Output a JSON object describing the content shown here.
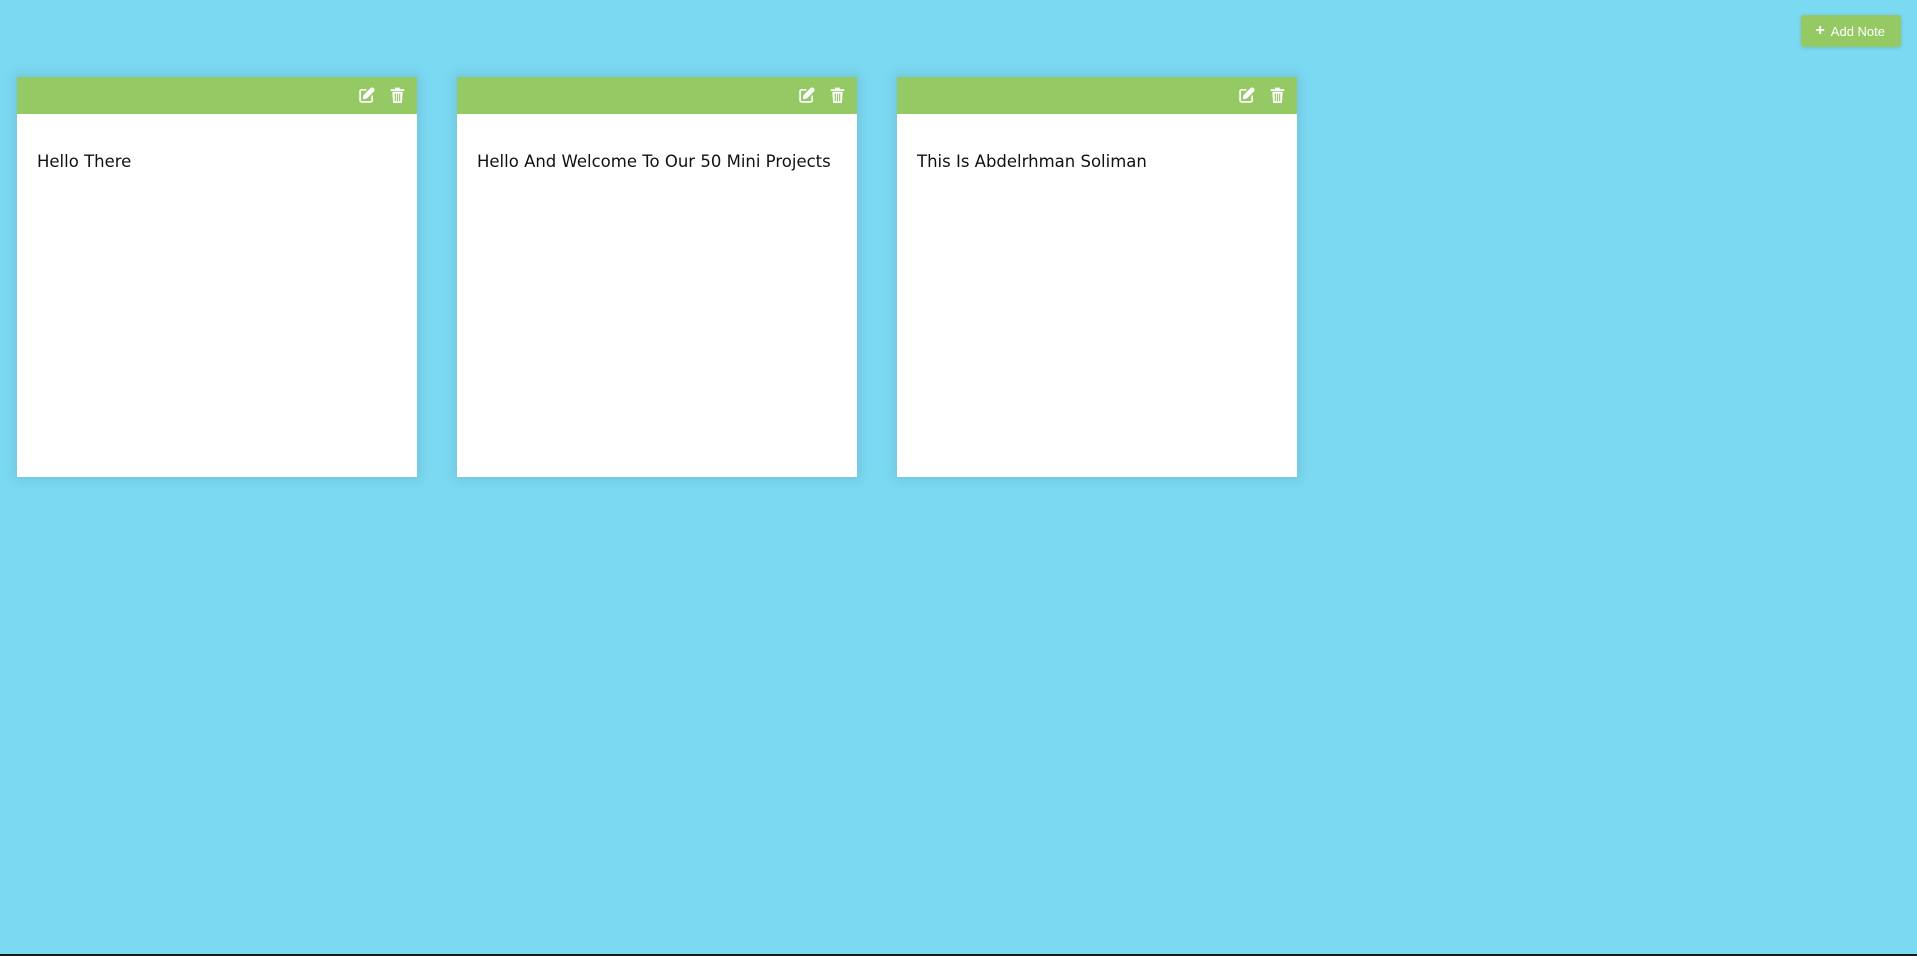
{
  "toolbar": {
    "add_icon": "plus-icon",
    "add_label": "Add Note"
  },
  "notes": [
    {
      "text": "Hello There",
      "edit_icon": "edit-icon",
      "delete_icon": "trash-icon"
    },
    {
      "text": "Hello And Welcome To Our 50 Mini Projects",
      "edit_icon": "edit-icon",
      "delete_icon": "trash-icon"
    },
    {
      "text": "This Is Abdelrhman Soliman",
      "edit_icon": "edit-icon",
      "delete_icon": "trash-icon"
    }
  ],
  "colors": {
    "background": "#7bd9f2",
    "accent": "#95c963",
    "note_background": "#ffffff"
  }
}
